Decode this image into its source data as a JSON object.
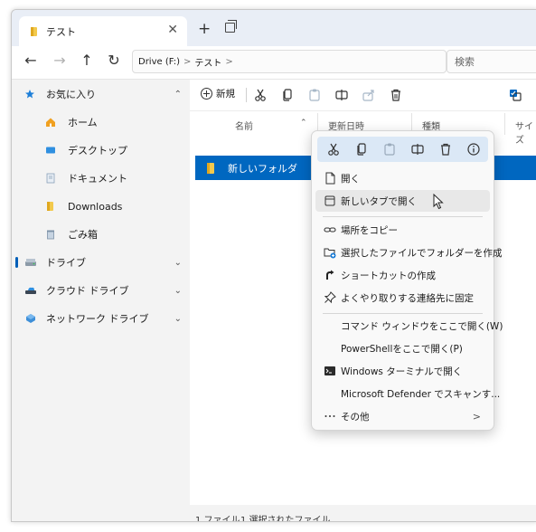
{
  "tab": {
    "title": "テスト",
    "close": "✕",
    "new_tab": "+"
  },
  "address": {
    "back": "←",
    "forward": "→",
    "up": "↑",
    "refresh": "↻",
    "segments": [
      "Drive (F:)",
      "テスト"
    ],
    "sep": ">",
    "search_placeholder": "検索"
  },
  "sidebar": {
    "items": [
      {
        "label": "お気に入り",
        "chevron": "⌃"
      },
      {
        "label": "ホーム"
      },
      {
        "label": "デスクトップ"
      },
      {
        "label": "ドキュメント"
      },
      {
        "label": "Downloads"
      },
      {
        "label": "ごみ箱"
      },
      {
        "label": "ドライブ",
        "chevron": "⌄"
      },
      {
        "label": "クラウド ドライブ",
        "chevron": "⌄"
      },
      {
        "label": "ネットワーク ドライブ",
        "chevron": "⌄"
      }
    ]
  },
  "toolbar": {
    "new_label": "新規"
  },
  "columns": {
    "name": "名前",
    "date": "更新日時",
    "type": "種類",
    "size": "サイズ",
    "sort_arrow": "⌃"
  },
  "files": [
    {
      "name": "新しいフォルダ"
    }
  ],
  "status": {
    "count": "1 ファイル",
    "selected": "1 選択されたファイル"
  },
  "context_menu": {
    "items": [
      {
        "label": "開く"
      },
      {
        "label": "新しいタブで開く"
      },
      {
        "label": "場所をコピー"
      },
      {
        "label": "選択したファイルでフォルダーを作成"
      },
      {
        "label": "ショートカットの作成"
      },
      {
        "label": "よくやり取りする連絡先に固定"
      },
      {
        "label": "コマンド ウィンドウをここで開く(W)"
      },
      {
        "label": "PowerShellをここで開く(P)"
      },
      {
        "label": "Windows ターミナルで開く"
      },
      {
        "label": "Microsoft Defender でスキャンす..."
      },
      {
        "label": "その他",
        "chevron": ">"
      }
    ]
  },
  "colors": {
    "accent": "#0067c0",
    "folder": "#f2c94c",
    "star": "#1e7fd8",
    "home": "#f0a020"
  }
}
